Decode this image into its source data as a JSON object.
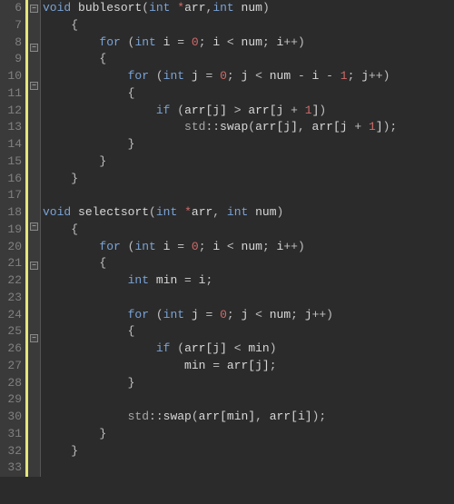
{
  "lines": [
    {
      "n": 6,
      "fold": "box",
      "tokens": [
        [
          "kw",
          "void"
        ],
        [
          "op",
          " "
        ],
        [
          "fn",
          "bublesort"
        ],
        [
          "punc",
          "("
        ],
        [
          "kw",
          "int"
        ],
        [
          "op",
          " "
        ],
        [
          "ptr",
          "*"
        ],
        [
          "ident",
          "arr"
        ],
        [
          "punc",
          ","
        ],
        [
          "kw",
          "int"
        ],
        [
          "op",
          " "
        ],
        [
          "ident",
          "num"
        ],
        [
          "punc",
          ")"
        ]
      ]
    },
    {
      "n": 7,
      "fold": "line",
      "indent": 1,
      "tokens": [
        [
          "brace",
          "{"
        ]
      ]
    },
    {
      "n": 8,
      "fold": "box",
      "indent": 2,
      "tokens": [
        [
          "kw",
          "for"
        ],
        [
          "op",
          " "
        ],
        [
          "punc",
          "("
        ],
        [
          "kw",
          "int"
        ],
        [
          "op",
          " "
        ],
        [
          "ident",
          "i"
        ],
        [
          "op",
          " = "
        ],
        [
          "num",
          "0"
        ],
        [
          "punc",
          "; "
        ],
        [
          "ident",
          "i"
        ],
        [
          "op",
          " < "
        ],
        [
          "ident",
          "num"
        ],
        [
          "punc",
          "; "
        ],
        [
          "ident",
          "i"
        ],
        [
          "op",
          "++"
        ],
        [
          "punc",
          ")"
        ]
      ]
    },
    {
      "n": 9,
      "fold": "line",
      "indent": 2,
      "tokens": [
        [
          "brace",
          "{"
        ]
      ]
    },
    {
      "n": 10,
      "fold": "box",
      "indent": 3,
      "tokens": [
        [
          "kw",
          "for"
        ],
        [
          "op",
          " "
        ],
        [
          "punc",
          "("
        ],
        [
          "kw",
          "int"
        ],
        [
          "op",
          " "
        ],
        [
          "ident",
          "j"
        ],
        [
          "op",
          " = "
        ],
        [
          "num",
          "0"
        ],
        [
          "punc",
          "; "
        ],
        [
          "ident",
          "j"
        ],
        [
          "op",
          " < "
        ],
        [
          "ident",
          "num"
        ],
        [
          "op",
          " - "
        ],
        [
          "ident",
          "i"
        ],
        [
          "op",
          " - "
        ],
        [
          "num",
          "1"
        ],
        [
          "punc",
          "; "
        ],
        [
          "ident",
          "j"
        ],
        [
          "op",
          "++"
        ],
        [
          "punc",
          ")"
        ]
      ]
    },
    {
      "n": 11,
      "fold": "line",
      "indent": 3,
      "tokens": [
        [
          "brace",
          "{"
        ]
      ]
    },
    {
      "n": 12,
      "fold": "line",
      "indent": 4,
      "tokens": [
        [
          "kw",
          "if"
        ],
        [
          "op",
          " "
        ],
        [
          "punc",
          "("
        ],
        [
          "ident",
          "arr"
        ],
        [
          "bracket",
          "["
        ],
        [
          "ident",
          "j"
        ],
        [
          "bracket",
          "]"
        ],
        [
          "op",
          " > "
        ],
        [
          "ident",
          "arr"
        ],
        [
          "bracket",
          "["
        ],
        [
          "ident",
          "j"
        ],
        [
          "op",
          " + "
        ],
        [
          "num",
          "1"
        ],
        [
          "bracket",
          "]"
        ],
        [
          "punc",
          ")"
        ]
      ]
    },
    {
      "n": 13,
      "fold": "line",
      "indent": 5,
      "tokens": [
        [
          "ns",
          "std"
        ],
        [
          "op",
          "::"
        ],
        [
          "fn",
          "swap"
        ],
        [
          "punc",
          "("
        ],
        [
          "ident",
          "arr"
        ],
        [
          "bracket",
          "["
        ],
        [
          "ident",
          "j"
        ],
        [
          "bracket",
          "]"
        ],
        [
          "punc",
          ", "
        ],
        [
          "ident",
          "arr"
        ],
        [
          "bracket",
          "["
        ],
        [
          "ident",
          "j"
        ],
        [
          "op",
          " + "
        ],
        [
          "num",
          "1"
        ],
        [
          "bracket",
          "]"
        ],
        [
          "punc",
          ");"
        ]
      ]
    },
    {
      "n": 14,
      "fold": "line",
      "indent": 3,
      "tokens": [
        [
          "brace",
          "}"
        ]
      ]
    },
    {
      "n": 15,
      "fold": "line",
      "indent": 2,
      "tokens": [
        [
          "brace",
          "}"
        ]
      ]
    },
    {
      "n": 16,
      "fold": "line",
      "indent": 1,
      "tokens": [
        [
          "brace",
          "}"
        ]
      ]
    },
    {
      "n": 17,
      "fold": "",
      "indent": 0,
      "tokens": []
    },
    {
      "n": 18,
      "fold": "box",
      "indent": 0,
      "tokens": [
        [
          "kw",
          "void"
        ],
        [
          "op",
          " "
        ],
        [
          "fn",
          "selectsort"
        ],
        [
          "punc",
          "("
        ],
        [
          "kw",
          "int"
        ],
        [
          "op",
          " "
        ],
        [
          "ptr",
          "*"
        ],
        [
          "ident",
          "arr"
        ],
        [
          "punc",
          ", "
        ],
        [
          "kw",
          "int"
        ],
        [
          "op",
          " "
        ],
        [
          "ident",
          "num"
        ],
        [
          "punc",
          ")"
        ]
      ]
    },
    {
      "n": 19,
      "fold": "line",
      "indent": 1,
      "tokens": [
        [
          "brace",
          "{"
        ]
      ]
    },
    {
      "n": 20,
      "fold": "box",
      "indent": 2,
      "tokens": [
        [
          "kw",
          "for"
        ],
        [
          "op",
          " "
        ],
        [
          "punc",
          "("
        ],
        [
          "kw",
          "int"
        ],
        [
          "op",
          " "
        ],
        [
          "ident",
          "i"
        ],
        [
          "op",
          " = "
        ],
        [
          "num",
          "0"
        ],
        [
          "punc",
          "; "
        ],
        [
          "ident",
          "i"
        ],
        [
          "op",
          " < "
        ],
        [
          "ident",
          "num"
        ],
        [
          "punc",
          "; "
        ],
        [
          "ident",
          "i"
        ],
        [
          "op",
          "++"
        ],
        [
          "punc",
          ")"
        ]
      ]
    },
    {
      "n": 21,
      "fold": "line",
      "indent": 2,
      "tokens": [
        [
          "brace",
          "{"
        ]
      ]
    },
    {
      "n": 22,
      "fold": "line",
      "indent": 3,
      "tokens": [
        [
          "kw",
          "int"
        ],
        [
          "op",
          " "
        ],
        [
          "ident",
          "min"
        ],
        [
          "op",
          " = "
        ],
        [
          "ident",
          "i"
        ],
        [
          "punc",
          ";"
        ]
      ]
    },
    {
      "n": 23,
      "fold": "line",
      "indent": 0,
      "tokens": []
    },
    {
      "n": 24,
      "fold": "box",
      "indent": 3,
      "tokens": [
        [
          "kw",
          "for"
        ],
        [
          "op",
          " "
        ],
        [
          "punc",
          "("
        ],
        [
          "kw",
          "int"
        ],
        [
          "op",
          " "
        ],
        [
          "ident",
          "j"
        ],
        [
          "op",
          " = "
        ],
        [
          "num",
          "0"
        ],
        [
          "punc",
          "; "
        ],
        [
          "ident",
          "j"
        ],
        [
          "op",
          " < "
        ],
        [
          "ident",
          "num"
        ],
        [
          "punc",
          "; "
        ],
        [
          "ident",
          "j"
        ],
        [
          "op",
          "++"
        ],
        [
          "punc",
          ")"
        ]
      ]
    },
    {
      "n": 25,
      "fold": "line",
      "indent": 3,
      "tokens": [
        [
          "brace",
          "{"
        ]
      ]
    },
    {
      "n": 26,
      "fold": "line",
      "indent": 4,
      "tokens": [
        [
          "kw",
          "if"
        ],
        [
          "op",
          " "
        ],
        [
          "punc",
          "("
        ],
        [
          "ident",
          "arr"
        ],
        [
          "bracket",
          "["
        ],
        [
          "ident",
          "j"
        ],
        [
          "bracket",
          "]"
        ],
        [
          "op",
          " < "
        ],
        [
          "ident",
          "min"
        ],
        [
          "punc",
          ")"
        ]
      ]
    },
    {
      "n": 27,
      "fold": "line",
      "indent": 5,
      "tokens": [
        [
          "ident",
          "min"
        ],
        [
          "op",
          " = "
        ],
        [
          "ident",
          "arr"
        ],
        [
          "bracket",
          "["
        ],
        [
          "ident",
          "j"
        ],
        [
          "bracket",
          "]"
        ],
        [
          "punc",
          ";"
        ]
      ]
    },
    {
      "n": 28,
      "fold": "line",
      "indent": 3,
      "tokens": [
        [
          "brace",
          "}"
        ]
      ]
    },
    {
      "n": 29,
      "fold": "line",
      "indent": 0,
      "tokens": []
    },
    {
      "n": 30,
      "fold": "line",
      "indent": 3,
      "tokens": [
        [
          "ns",
          "std"
        ],
        [
          "op",
          "::"
        ],
        [
          "fn",
          "swap"
        ],
        [
          "punc",
          "("
        ],
        [
          "ident",
          "arr"
        ],
        [
          "bracket",
          "["
        ],
        [
          "ident",
          "min"
        ],
        [
          "bracket",
          "]"
        ],
        [
          "punc",
          ", "
        ],
        [
          "ident",
          "arr"
        ],
        [
          "bracket",
          "["
        ],
        [
          "ident",
          "i"
        ],
        [
          "bracket",
          "]"
        ],
        [
          "punc",
          ");"
        ]
      ]
    },
    {
      "n": 31,
      "fold": "line",
      "indent": 2,
      "tokens": [
        [
          "brace",
          "}"
        ]
      ]
    },
    {
      "n": 32,
      "fold": "line",
      "indent": 1,
      "tokens": [
        [
          "brace",
          "}"
        ]
      ]
    },
    {
      "n": 33,
      "fold": "",
      "indent": 0,
      "tokens": []
    }
  ],
  "indentUnit": "    ",
  "foldGlyph": "−"
}
